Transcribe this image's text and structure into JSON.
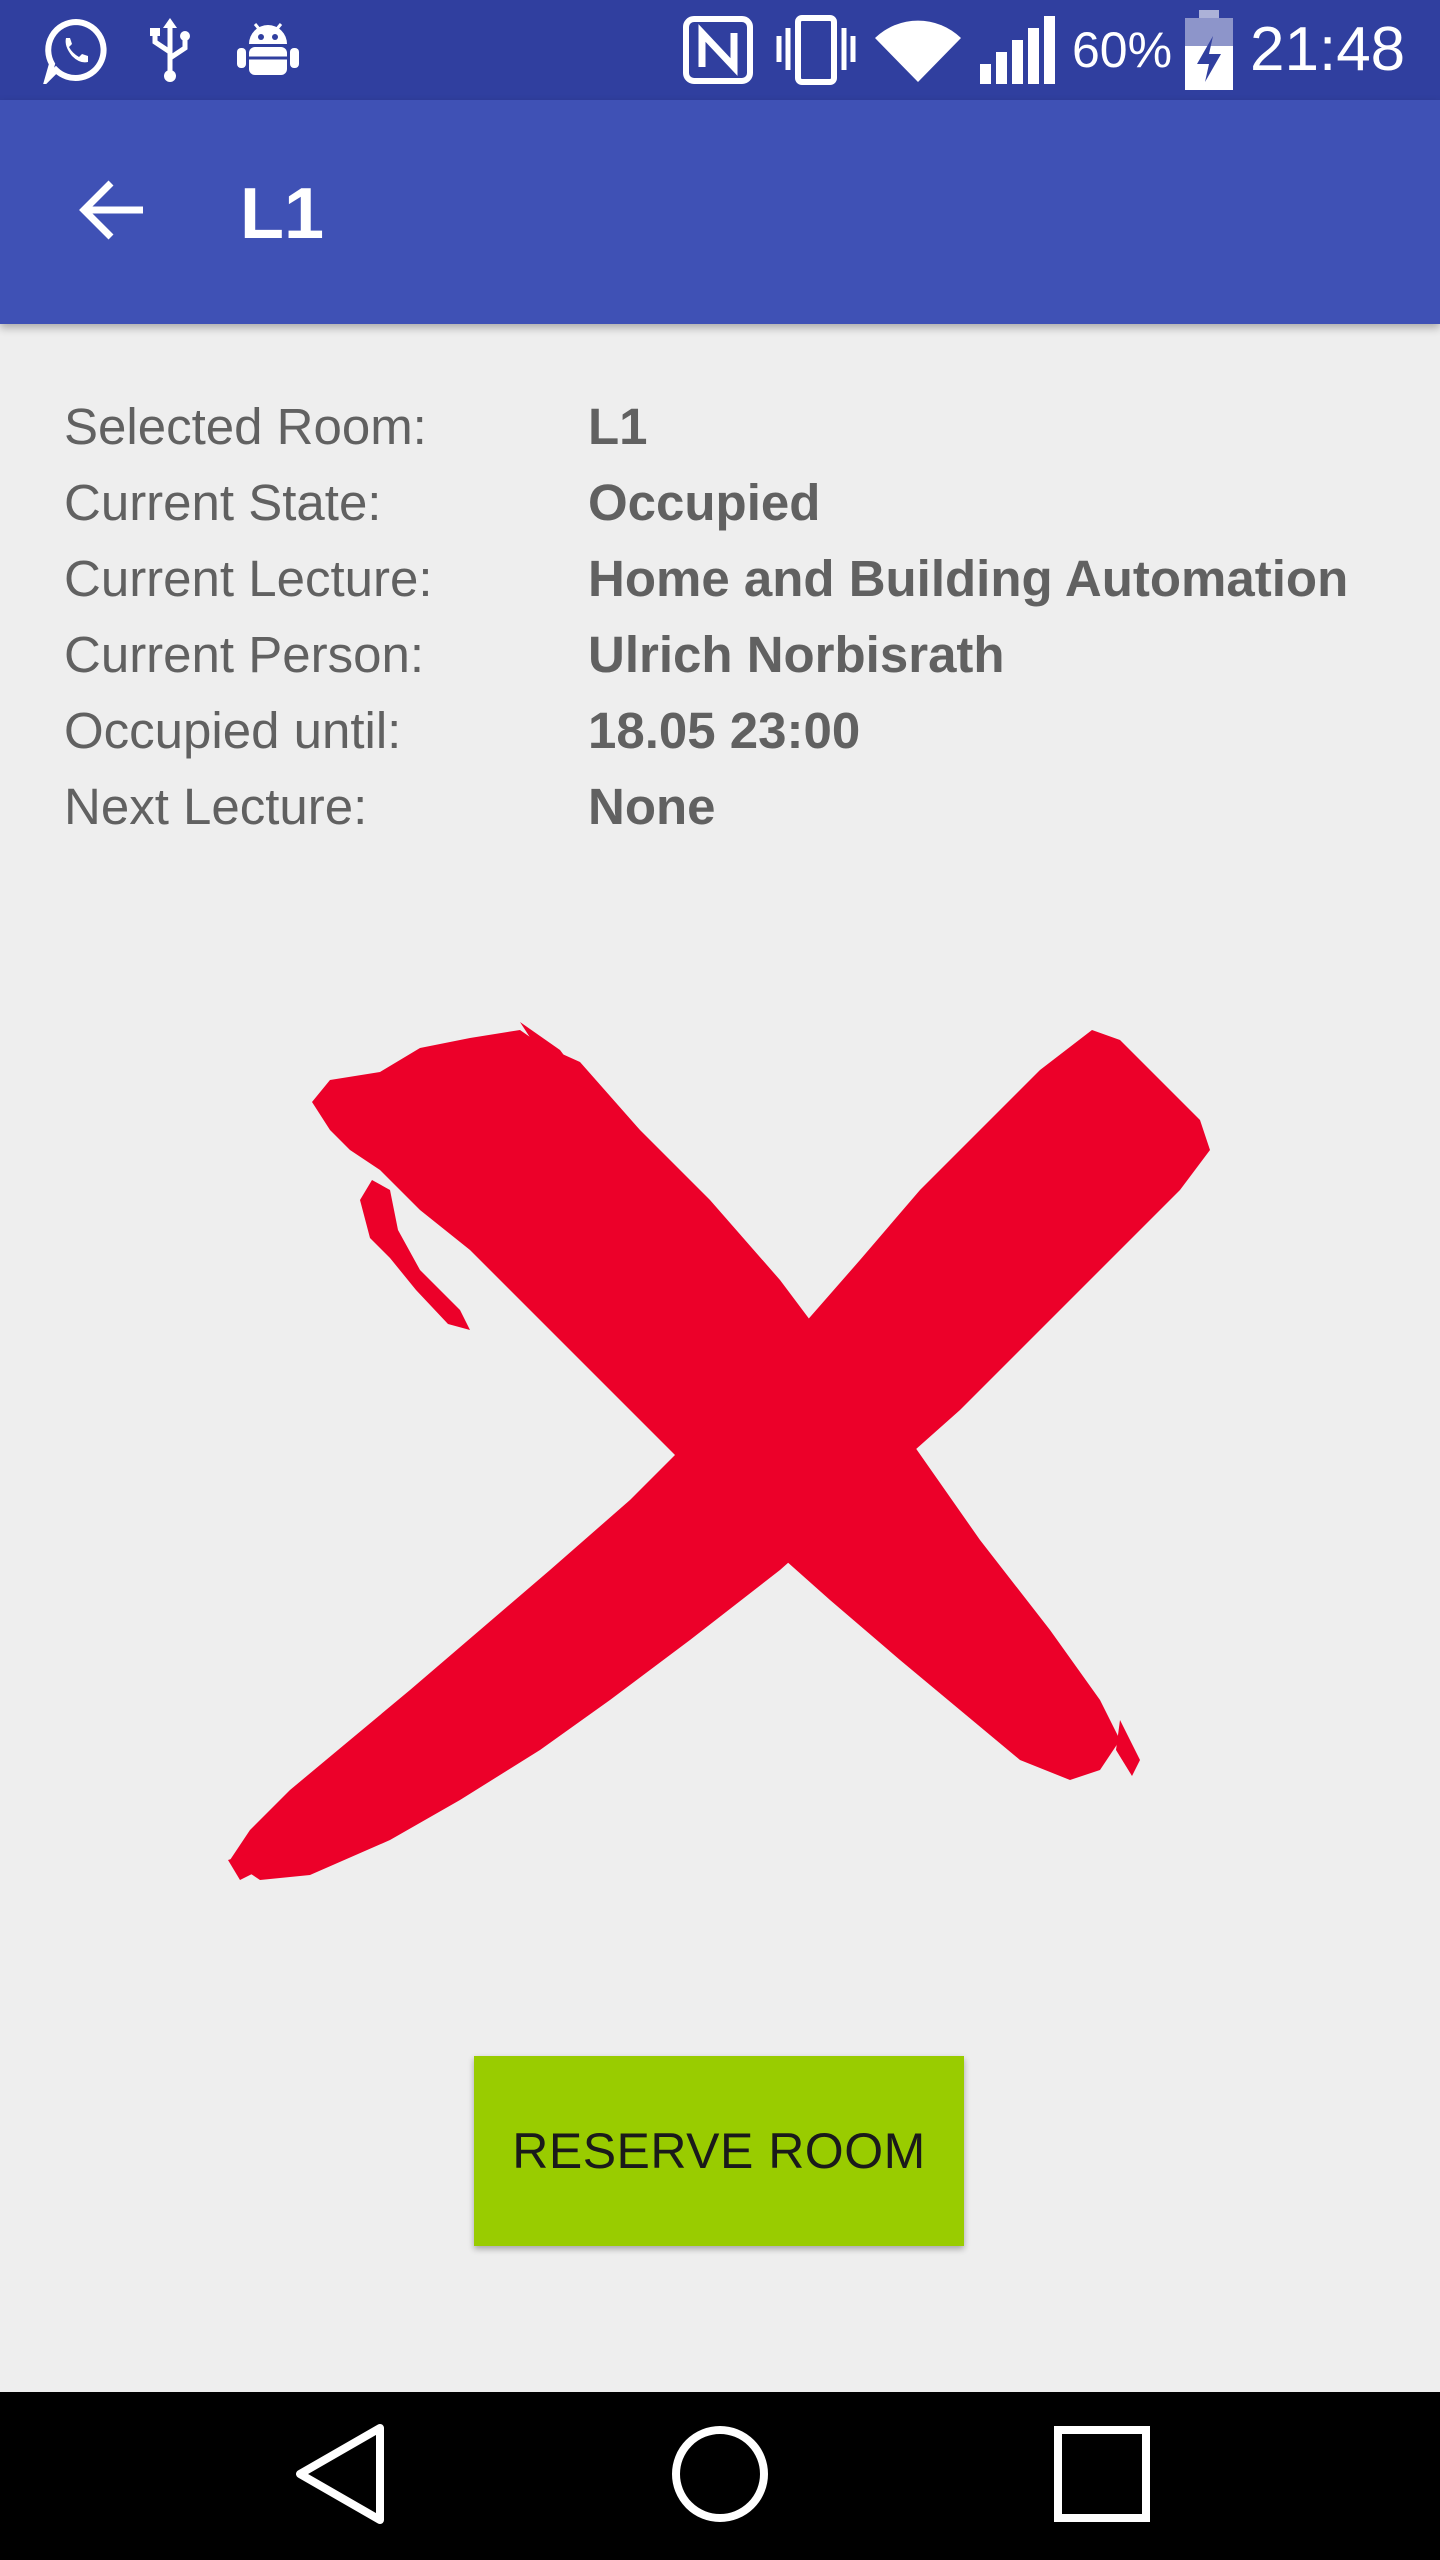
{
  "status_bar": {
    "battery_text": "60%",
    "time": "21:48",
    "left_icons": [
      "whatsapp-icon",
      "usb-icon",
      "android-debug-icon"
    ],
    "right_icons": [
      "nfc-icon",
      "vibrate-icon",
      "wifi-icon",
      "signal-icon",
      "battery-charging-icon"
    ]
  },
  "app_bar": {
    "title": "L1",
    "back_icon": "arrow-back-icon",
    "color": "#3f51b5",
    "status_color": "#303f9f"
  },
  "info": {
    "rows": [
      {
        "label": "Selected Room:",
        "value": "L1"
      },
      {
        "label": "Current State:",
        "value": "Occupied"
      },
      {
        "label": "Current Lecture:",
        "value": "Home and Building Automation"
      },
      {
        "label": "Current Person:",
        "value": "Ulrich Norbisrath"
      },
      {
        "label": "Occupied until:",
        "value": "18.05 23:00"
      },
      {
        "label": "Next Lecture:",
        "value": "None"
      }
    ]
  },
  "state_image": {
    "icon": "red-x-mark-icon",
    "color": "#ec0029"
  },
  "reserve_button": {
    "label": "RESERVE ROOM",
    "color": "#99cc00"
  },
  "nav_bar": {
    "icons": [
      "back-triangle-icon",
      "home-circle-icon",
      "recents-square-icon"
    ]
  }
}
